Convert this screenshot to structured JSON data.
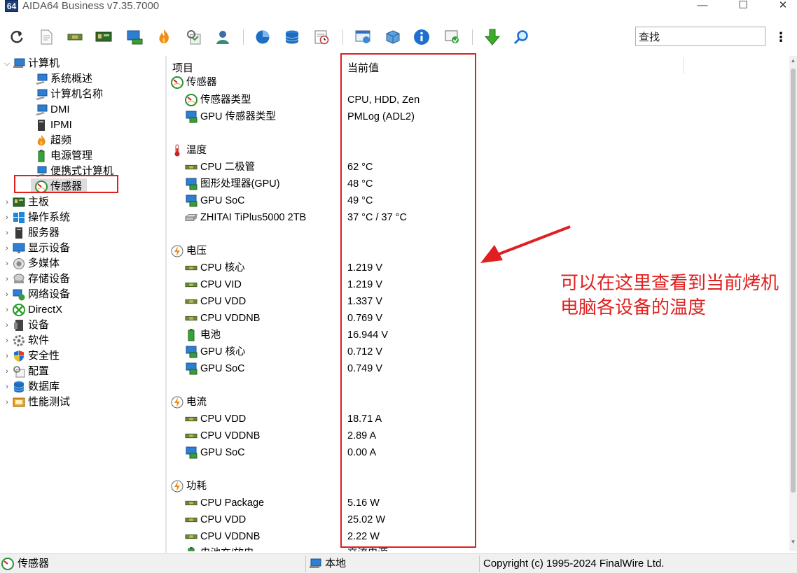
{
  "window": {
    "logo_text": "64",
    "title": "AIDA64 Business v7.35.7000",
    "minimize": "—",
    "maximize": "☐",
    "close": "✕"
  },
  "toolbar": {
    "search_value": "查找",
    "menu_dots": "⋮"
  },
  "tree": {
    "computer": "计算机",
    "children": [
      "系统概述",
      "计算机名称",
      "DMI",
      "IPMI",
      "超频",
      "电源管理",
      "便携式计算机",
      "传感器"
    ],
    "top_items": [
      "主板",
      "操作系统",
      "服务器",
      "显示设备",
      "多媒体",
      "存储设备",
      "网络设备",
      "DirectX",
      "设备",
      "软件",
      "安全性",
      "配置",
      "数据库",
      "性能测试"
    ]
  },
  "list": {
    "col_item": "项目",
    "col_value": "当前值",
    "groups": [
      {
        "title": "传感器",
        "rows": [
          {
            "label": "传感器类型",
            "value": "CPU, HDD, Zen"
          },
          {
            "label": "GPU 传感器类型",
            "value": "PMLog  (ADL2)"
          }
        ]
      },
      {
        "title": "温度",
        "rows": [
          {
            "label": "CPU 二极管",
            "value": "62 °C"
          },
          {
            "label": "图形处理器(GPU)",
            "value": "48 °C"
          },
          {
            "label": "GPU SoC",
            "value": "49 °C"
          },
          {
            "label": "ZHITAI TiPlus5000 2TB",
            "value": "37 °C / 37 °C"
          }
        ]
      },
      {
        "title": "电压",
        "rows": [
          {
            "label": "CPU 核心",
            "value": "1.219 V"
          },
          {
            "label": "CPU VID",
            "value": "1.219 V"
          },
          {
            "label": "CPU VDD",
            "value": "1.337 V"
          },
          {
            "label": "CPU VDDNB",
            "value": "0.769 V"
          },
          {
            "label": "电池",
            "value": "16.944 V"
          },
          {
            "label": "GPU 核心",
            "value": "0.712 V"
          },
          {
            "label": "GPU SoC",
            "value": "0.749 V"
          }
        ]
      },
      {
        "title": "电流",
        "rows": [
          {
            "label": "CPU VDD",
            "value": "18.71 A"
          },
          {
            "label": "CPU VDDNB",
            "value": "2.89 A"
          },
          {
            "label": "GPU SoC",
            "value": "0.00 A"
          }
        ]
      },
      {
        "title": "功耗",
        "rows": [
          {
            "label": "CPU Package",
            "value": "5.16 W"
          },
          {
            "label": "CPU VDD",
            "value": "25.02 W"
          },
          {
            "label": "CPU VDDNB",
            "value": "2.22 W"
          },
          {
            "label": "电池充/放电",
            "value": "交流电源"
          }
        ]
      }
    ]
  },
  "annotation": {
    "text_line1": "可以在这里查看到当前烤机",
    "text_line2": "电脑各设备的温度",
    "color": "#e02020"
  },
  "statusbar": {
    "left": "传感器",
    "middle": "本地",
    "right": "Copyright (c) 1995-2024 FinalWire Ltd."
  }
}
